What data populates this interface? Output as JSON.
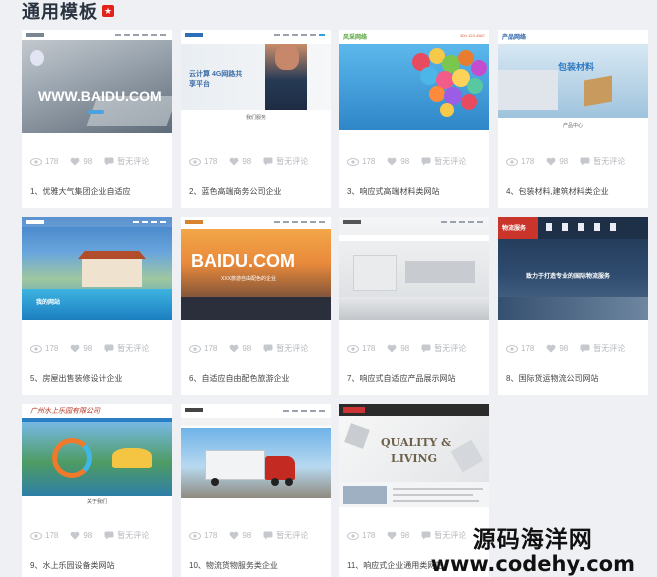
{
  "header": {
    "title": "通用模板",
    "hot_badge_icon": "hot-badge-icon"
  },
  "templates": [
    {
      "title": "1、优雅大气集团企业自适应",
      "views": "178",
      "likes": "98",
      "comments": "暂无评论",
      "banner": "WWW.BAIDU.COM"
    },
    {
      "title": "2、蓝色高端商务公司企业",
      "views": "178",
      "likes": "98",
      "comments": "暂无评论",
      "banner": "云计算 4G网路共享平台",
      "section": "我们服务"
    },
    {
      "title": "3、响应式高端材料类网站",
      "views": "178",
      "likes": "98",
      "comments": "暂无评论",
      "logo": "风采网络",
      "phone": "400-123-4567"
    },
    {
      "title": "4、包装材料,建筑材料类企业",
      "views": "178",
      "likes": "98",
      "comments": "暂无评论",
      "logo": "产品网络",
      "banner": "包装材料",
      "section": "产品中心"
    },
    {
      "title": "5、房屋出售装修设计企业",
      "views": "178",
      "likes": "98",
      "comments": "暂无评论",
      "banner": "我的网站"
    },
    {
      "title": "6、自适应自由配色旅游企业",
      "views": "178",
      "likes": "98",
      "comments": "暂无评论",
      "banner": "BAIDU.COM",
      "sub": "XXX旅游自由配色的企业"
    },
    {
      "title": "7、响应式自适应产品展示网站",
      "views": "178",
      "likes": "98",
      "comments": "暂无评论"
    },
    {
      "title": "8、国际货运物流公司网站",
      "views": "178",
      "likes": "98",
      "comments": "暂无评论",
      "logo": "物流服务",
      "banner": "致力于打造专业的国际物流服务"
    },
    {
      "title": "9、水上乐园设备类网站",
      "views": "178",
      "likes": "98",
      "comments": "暂无评论",
      "logo": "广州水上乐园有限公司",
      "section": "关于我们"
    },
    {
      "title": "10、物流货物服务类企业",
      "views": "178",
      "likes": "98",
      "comments": "暂无评论"
    },
    {
      "title": "11、响应式企业通用类网站",
      "views": "178",
      "likes": "98",
      "comments": "暂无评论",
      "banner1": "QUALITY &",
      "banner2": "LIVING"
    }
  ],
  "watermark": {
    "line1": "源码海洋网",
    "line2": "www.codehy.com"
  },
  "colors": {
    "background": "#eef0f3",
    "accent_red": "#e2231a",
    "meta_gray": "#b6b9be"
  }
}
